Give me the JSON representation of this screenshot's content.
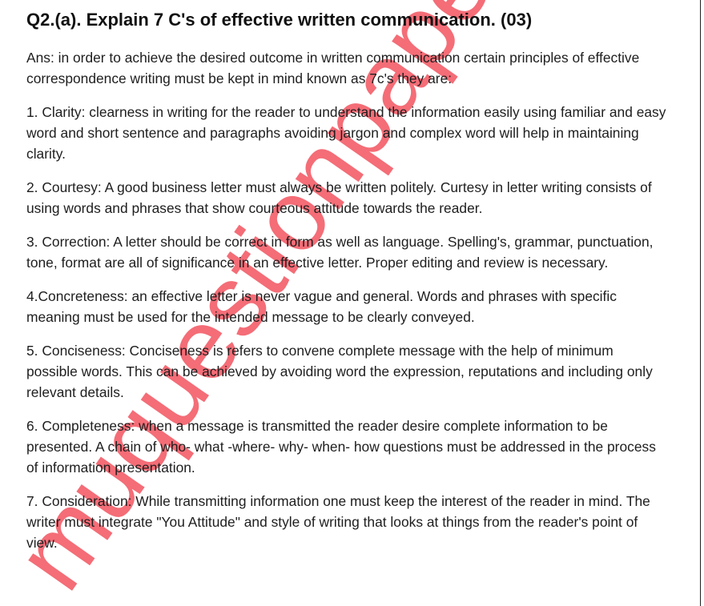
{
  "document": {
    "heading": "Q2.(a). Explain 7 C's of effective written communication. (03)",
    "paragraphs": [
      "Ans: in order to achieve the desired outcome in written communication certain principles of effective correspondence writing must be kept in mind known as 7c's they are:",
      "1. Clarity: clearness in writing for the reader to understand the information easily using familiar and easy word and short sentence and paragraphs avoiding jargon and complex word will help in maintaining clarity.",
      "2. Courtesy: A good business letter must always be written politely. Curtesy in letter writing consists of using words and phrases that show courteous attitude towards the reader.",
      "3. Correction: A letter should be correct in form as well as language. Spelling's, grammar, punctuation, tone, format are all of significance in an effective letter. Proper editing and review is necessary.",
      "4.Concreteness: an effective letter is never vague and general. Words and phrases with specific meaning must be used for the intended message to be clearly conveyed.",
      "5. Conciseness: Conciseness is refers to convene complete message with the help of minimum possible words. This can be achieved by avoiding word the expression, reputations and including only relevant details.",
      "6. Completeness: when a message is transmitted the reader desire complete information to be presented. A chain of who- what -where- why- when- how questions must be addressed in the process of information presentation.",
      "7. Consideration: While transmitting information one must keep the interest of the reader in mind. The writer must integrate \"You Attitude\" and style of writing that looks at things from the reader's point of view."
    ]
  },
  "watermark": {
    "text": "muquestionpapers.co",
    "color": "#f2545f"
  }
}
